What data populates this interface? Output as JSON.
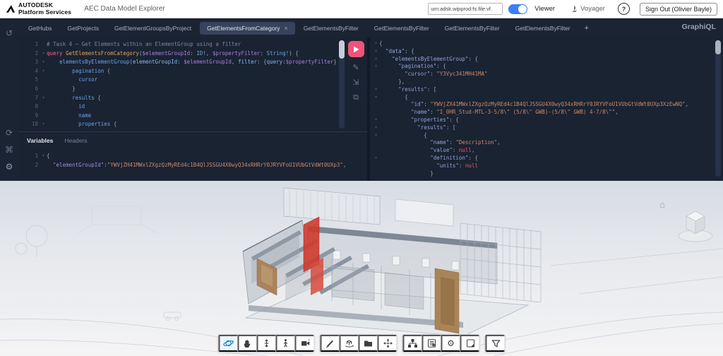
{
  "header": {
    "brand_line1": "AUTODESK",
    "brand_line2": "Platform Services",
    "app_title": "AEC Data Model Explorer",
    "urn_value": "urn:adsk.wipprod:fs.file:vf.",
    "viewer_toggle_label": "Viewer",
    "voyager_label": "Voyager",
    "help_label": "?",
    "sign_out_label": "Sign Out (Olivier Bayle)"
  },
  "colors": {
    "accent_play": "#f0537a",
    "toggle_blue": "#3d7df6",
    "orbit_blue": "#0a84d0",
    "highlight_red": "#ce3a2d",
    "door_brown": "#a8835b"
  },
  "tabs": {
    "items": [
      {
        "label": "GetHubs",
        "active": false
      },
      {
        "label": "GetProjects",
        "active": false
      },
      {
        "label": "GetElementGroupsByProject",
        "active": false
      },
      {
        "label": "GetElementsFromCategory",
        "active": true,
        "close": "×"
      },
      {
        "label": "GetElementsByFilter",
        "active": false
      },
      {
        "label": "GetElementsByFilter",
        "active": false
      },
      {
        "label": "GetElementsByFilter",
        "active": false
      },
      {
        "label": "GetElementsByFilter",
        "active": false
      }
    ],
    "add_label": "+",
    "logo": "GraphiQL"
  },
  "sidebar_icons": [
    "history-icon",
    "re-fetch-schema-icon",
    "keyboard-shortcuts-icon",
    "settings-icon"
  ],
  "editor_toolbar_icons": [
    "execute-query-button",
    "prettify-icon",
    "merge-fragments-icon",
    "copy-query-icon"
  ],
  "editor": {
    "lines": [
      {
        "n": "1",
        "fold": false,
        "t": [
          [
            "# Task 4 — Get Elements within an ElementGroup using a filter",
            "c"
          ]
        ]
      },
      {
        "n": "2",
        "fold": true,
        "t": [
          [
            "query",
            "k"
          ],
          [
            " ",
            ""
          ],
          [
            "GetElementsFromCategory",
            "on"
          ],
          [
            "(",
            ""
          ],
          [
            "$elementGroupId",
            "v"
          ],
          [
            ": ",
            ""
          ],
          [
            "ID!",
            "ty"
          ],
          [
            ", ",
            ""
          ],
          [
            "$propertyFilter",
            "v"
          ],
          [
            ": ",
            ""
          ],
          [
            "String!",
            "ty"
          ],
          [
            ") {",
            ""
          ]
        ]
      },
      {
        "n": "3",
        "fold": true,
        "t": [
          [
            "    ",
            ""
          ],
          [
            "elementsByElementGroup",
            "f"
          ],
          [
            "(",
            ""
          ],
          [
            "elementGroupId:",
            "a"
          ],
          [
            " ",
            ""
          ],
          [
            "$elementGroupId",
            "v"
          ],
          [
            ", ",
            ""
          ],
          [
            "filter:",
            "a"
          ],
          [
            " {",
            ""
          ],
          [
            "query",
            "a"
          ],
          [
            ":",
            ""
          ],
          [
            "$propertyFilter",
            "v"
          ],
          [
            "}) {",
            ""
          ]
        ]
      },
      {
        "n": "4",
        "fold": true,
        "t": [
          [
            "        ",
            ""
          ],
          [
            "pagination",
            "f"
          ],
          [
            " {",
            ""
          ]
        ]
      },
      {
        "n": "5",
        "fold": false,
        "t": [
          [
            "          ",
            ""
          ],
          [
            "cursor",
            "f"
          ]
        ]
      },
      {
        "n": "6",
        "fold": false,
        "t": [
          [
            "        }",
            ""
          ]
        ]
      },
      {
        "n": "7",
        "fold": true,
        "t": [
          [
            "        ",
            ""
          ],
          [
            "results",
            "f"
          ],
          [
            " {",
            ""
          ]
        ]
      },
      {
        "n": "8",
        "fold": false,
        "t": [
          [
            "          ",
            ""
          ],
          [
            "id",
            "f"
          ]
        ]
      },
      {
        "n": "9",
        "fold": false,
        "t": [
          [
            "          ",
            ""
          ],
          [
            "name",
            "f"
          ]
        ]
      },
      {
        "n": "10",
        "fold": true,
        "t": [
          [
            "          ",
            ""
          ],
          [
            "properties",
            "f"
          ],
          [
            " {",
            ""
          ]
        ]
      }
    ]
  },
  "variables_panel": {
    "tabs": [
      {
        "label": "Variables",
        "active": true
      },
      {
        "label": "Headers",
        "active": false
      }
    ],
    "lines": [
      {
        "n": "1",
        "fold": true,
        "t": [
          [
            "{",
            ""
          ]
        ]
      },
      {
        "n": "2",
        "fold": false,
        "t": [
          [
            "  ",
            ""
          ],
          [
            "\"elementGroupId\"",
            "vkey"
          ],
          [
            ":",
            ""
          ],
          [
            "\"YWVjZH41MWxlZXgzQzMyREd4c1B4QlJSSGU4X0wyQ34xRHRrY0JRYVFoU1VUbGtVdWt0UXp3\"",
            "str"
          ],
          [
            ",",
            ""
          ]
        ]
      }
    ]
  },
  "response": {
    "lines": [
      {
        "fold": true,
        "t": [
          [
            "{",
            ""
          ]
        ]
      },
      {
        "fold": true,
        "t": [
          [
            "  ",
            ""
          ],
          [
            "\"data\"",
            "key"
          ],
          [
            ": {",
            ""
          ]
        ]
      },
      {
        "fold": true,
        "t": [
          [
            "    ",
            ""
          ],
          [
            "\"elementsByElementGroup\"",
            "key"
          ],
          [
            ": {",
            ""
          ]
        ]
      },
      {
        "fold": true,
        "t": [
          [
            "      ",
            ""
          ],
          [
            "\"pagination\"",
            "key"
          ],
          [
            ": {",
            ""
          ]
        ]
      },
      {
        "fold": false,
        "t": [
          [
            "        ",
            ""
          ],
          [
            "\"cursor\"",
            "key"
          ],
          [
            ": ",
            ""
          ],
          [
            "\"Y3Vyc341MH41MA\"",
            "str"
          ]
        ]
      },
      {
        "fold": false,
        "t": [
          [
            "      },",
            ""
          ]
        ]
      },
      {
        "fold": true,
        "t": [
          [
            "      ",
            ""
          ],
          [
            "\"results\"",
            "key"
          ],
          [
            ": [",
            ""
          ]
        ]
      },
      {
        "fold": true,
        "t": [
          [
            "        {",
            ""
          ]
        ]
      },
      {
        "fold": false,
        "t": [
          [
            "          ",
            ""
          ],
          [
            "\"id\"",
            "key"
          ],
          [
            ": ",
            ""
          ],
          [
            "\"YWVjZX41MWxlZXgzQzMyREd4c1B4QlJSSGU4X0wyQ34xRHRrY0JRYVFoU1VUbGtVdWt0UXp3XzEwNQ\"",
            "str"
          ],
          [
            ",",
            ""
          ]
        ]
      },
      {
        "fold": false,
        "t": [
          [
            "          ",
            ""
          ],
          [
            "\"name\"",
            "key"
          ],
          [
            ": ",
            ""
          ],
          [
            "\"I_0HR_Stud-MTL-3-5/8\\\" (5/8\\\" GWB)-(5/8\\\" GWB) 4-7/8\\\"\"",
            "str"
          ],
          [
            ",",
            ""
          ]
        ]
      },
      {
        "fold": true,
        "t": [
          [
            "          ",
            ""
          ],
          [
            "\"properties\"",
            "key"
          ],
          [
            ": {",
            ""
          ]
        ]
      },
      {
        "fold": true,
        "t": [
          [
            "            ",
            ""
          ],
          [
            "\"results\"",
            "key"
          ],
          [
            ": [",
            ""
          ]
        ]
      },
      {
        "fold": true,
        "t": [
          [
            "              {",
            ""
          ]
        ]
      },
      {
        "fold": false,
        "t": [
          [
            "                ",
            ""
          ],
          [
            "\"name\"",
            "key"
          ],
          [
            ": ",
            ""
          ],
          [
            "\"Description\"",
            "str"
          ],
          [
            ",",
            ""
          ]
        ]
      },
      {
        "fold": false,
        "t": [
          [
            "                ",
            ""
          ],
          [
            "\"value\"",
            "key"
          ],
          [
            ": ",
            ""
          ],
          [
            "null",
            "nul"
          ],
          [
            ",",
            ""
          ]
        ]
      },
      {
        "fold": true,
        "t": [
          [
            "                ",
            ""
          ],
          [
            "\"definition\"",
            "key"
          ],
          [
            ": {",
            ""
          ]
        ]
      },
      {
        "fold": false,
        "t": [
          [
            "                  ",
            ""
          ],
          [
            "\"units\"",
            "key"
          ],
          [
            ": ",
            ""
          ],
          [
            "null",
            "nul"
          ]
        ]
      },
      {
        "fold": false,
        "t": [
          [
            "                }",
            ""
          ]
        ]
      }
    ]
  },
  "viewer": {
    "home_icon": "⌂",
    "toolbar_icons": [
      "orbit-icon",
      "pan-icon",
      "zoom-icon",
      "first-person-icon",
      "camera-icon",
      "measure-icon",
      "section-analysis-icon",
      "folder-icon",
      "explode-icon",
      "model-browser-icon",
      "properties-icon",
      "settings-icon",
      "fullscreen-icon",
      "filter-icon"
    ]
  }
}
